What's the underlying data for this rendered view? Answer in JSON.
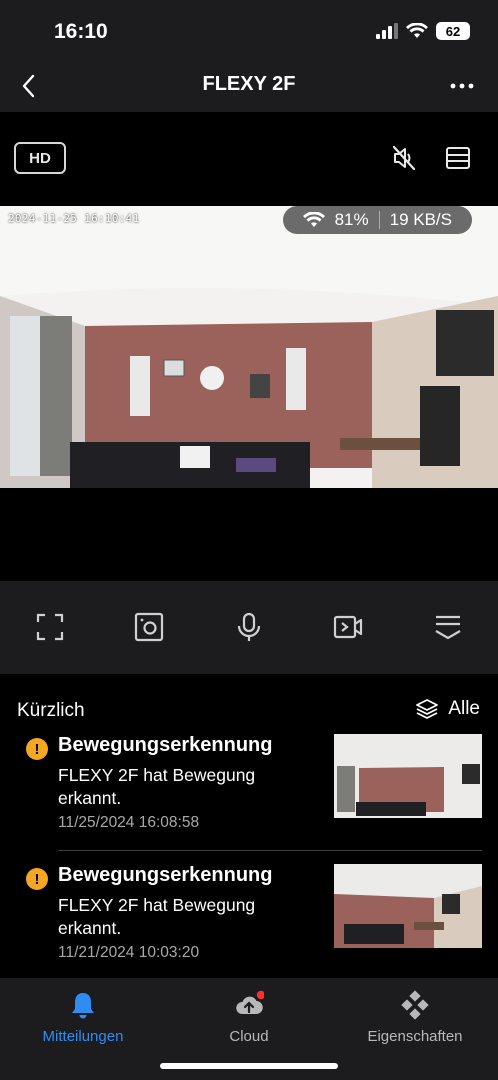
{
  "status_bar": {
    "time": "16:10",
    "battery": "62"
  },
  "nav": {
    "title": "FLEXY 2F"
  },
  "toolbar": {
    "quality": "HD"
  },
  "video": {
    "timestamp": "2024-11-25 16:10:41",
    "wifi_signal": "81%",
    "bitrate": "19 KB/S"
  },
  "recent": {
    "title": "Kürzlich",
    "filter_label": "Alle",
    "events": [
      {
        "title": "Bewegungserkennung",
        "description": "FLEXY 2F hat Bewegung erkannt.",
        "time": "11/25/2024 16:08:58"
      },
      {
        "title": "Bewegungserkennung",
        "description": "FLEXY 2F hat Bewegung erkannt.",
        "time": "11/21/2024 10:03:20"
      }
    ]
  },
  "tabs": [
    {
      "label": "Mitteilungen",
      "icon": "bell-icon",
      "active": true
    },
    {
      "label": "Cloud",
      "icon": "cloud-upload-icon",
      "active": false
    },
    {
      "label": "Eigenschaften",
      "icon": "properties-icon",
      "active": false
    }
  ],
  "colors": {
    "accent": "#2f8cf0",
    "warning": "#f5a623",
    "badge": "#ff2d2d",
    "surface": "#1c1c1e"
  }
}
